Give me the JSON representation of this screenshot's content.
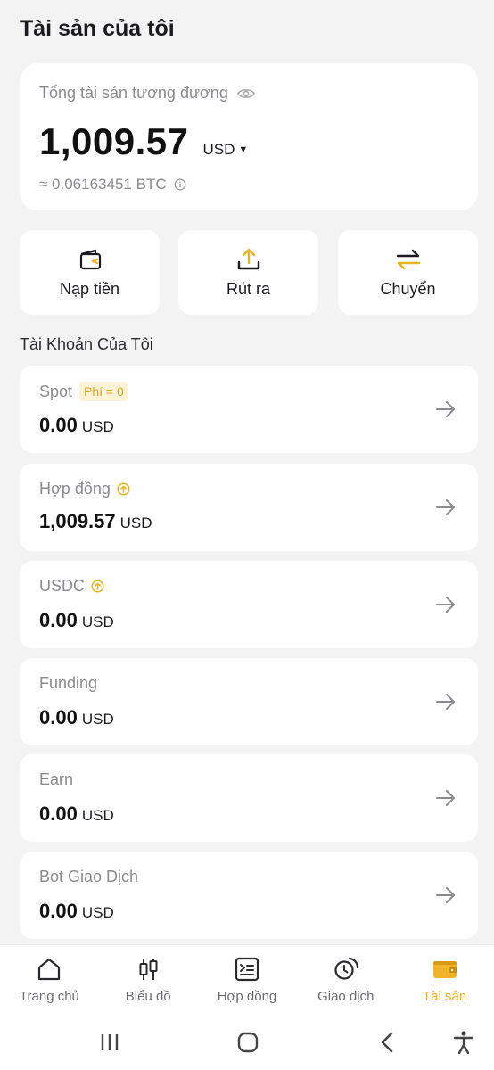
{
  "header": {
    "title": "Tài sản của tôi"
  },
  "total": {
    "label": "Tổng tài sản tương đương",
    "value": "1,009.57",
    "currency": "USD",
    "btc_equivalent": "≈ 0.06163451 BTC"
  },
  "actions": {
    "deposit": "Nạp tiền",
    "withdraw": "Rút ra",
    "transfer": "Chuyển"
  },
  "accounts_section": {
    "title": "Tài Khoản Của Tôi",
    "items": [
      {
        "name": "Spot",
        "badge": "Phí = 0",
        "amount": "0.00",
        "currency": "USD"
      },
      {
        "name": "Hợp đồng",
        "amount": "1,009.57",
        "currency": "USD"
      },
      {
        "name": "USDC",
        "amount": "0.00",
        "currency": "USD"
      },
      {
        "name": "Funding",
        "amount": "0.00",
        "currency": "USD"
      },
      {
        "name": "Earn",
        "amount": "0.00",
        "currency": "USD"
      },
      {
        "name": "Bot Giao Dịch",
        "amount": "0.00",
        "currency": "USD"
      }
    ]
  },
  "bottom_nav": {
    "items": [
      {
        "label": "Trang chủ",
        "icon": "home-icon"
      },
      {
        "label": "Biểu đồ",
        "icon": "candlestick-icon"
      },
      {
        "label": "Hợp đồng",
        "icon": "futures-icon"
      },
      {
        "label": "Giao dịch",
        "icon": "trade-icon"
      },
      {
        "label": "Tài sản",
        "icon": "wallet-icon",
        "active": true
      }
    ]
  },
  "colors": {
    "accent": "#e8b220",
    "background": "#f3f3f4",
    "card": "#ffffff"
  }
}
